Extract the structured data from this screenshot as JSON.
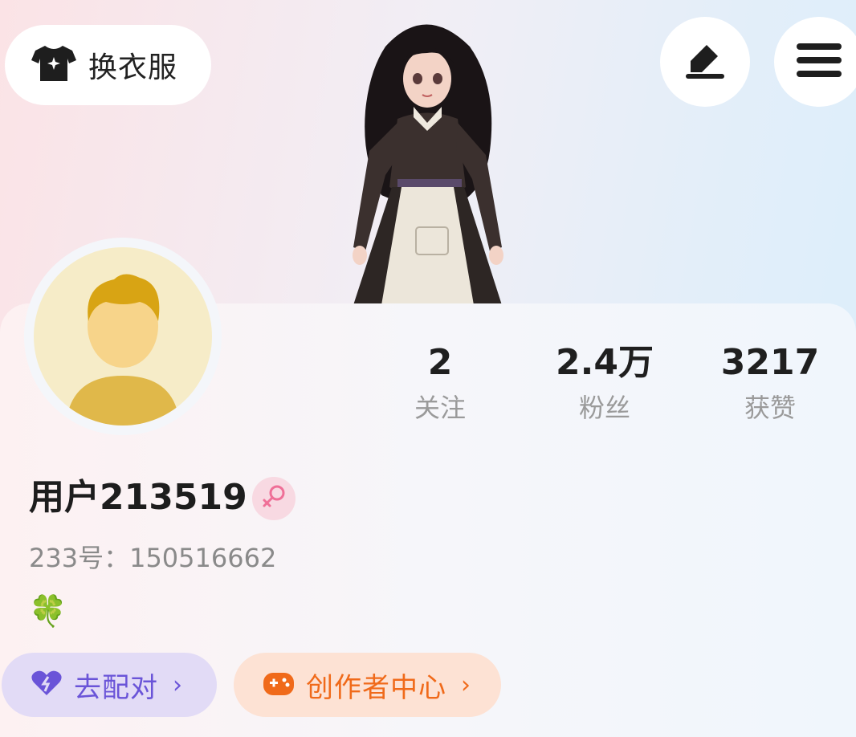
{
  "top_bar": {
    "change_outfit_label": "换衣服",
    "icons": {
      "outfit": "tshirt-icon",
      "edit": "pen-edit-icon",
      "menu": "hamburger-menu-icon"
    }
  },
  "profile": {
    "username": "用户213519",
    "user_id_text": "233号：150516662",
    "clover": "🍀",
    "gender_icon": "female-symbol-icon"
  },
  "stats": [
    {
      "value": "2",
      "label": "关注"
    },
    {
      "value": "2.4万",
      "label": "粉丝"
    },
    {
      "value": "3217",
      "label": "获赞"
    }
  ],
  "actions": {
    "match_label": "去配对",
    "creator_label": "创作者中心",
    "chevron": "›"
  },
  "colors": {
    "match_accent": "#6a54d8",
    "creator_accent": "#f06a1a"
  }
}
